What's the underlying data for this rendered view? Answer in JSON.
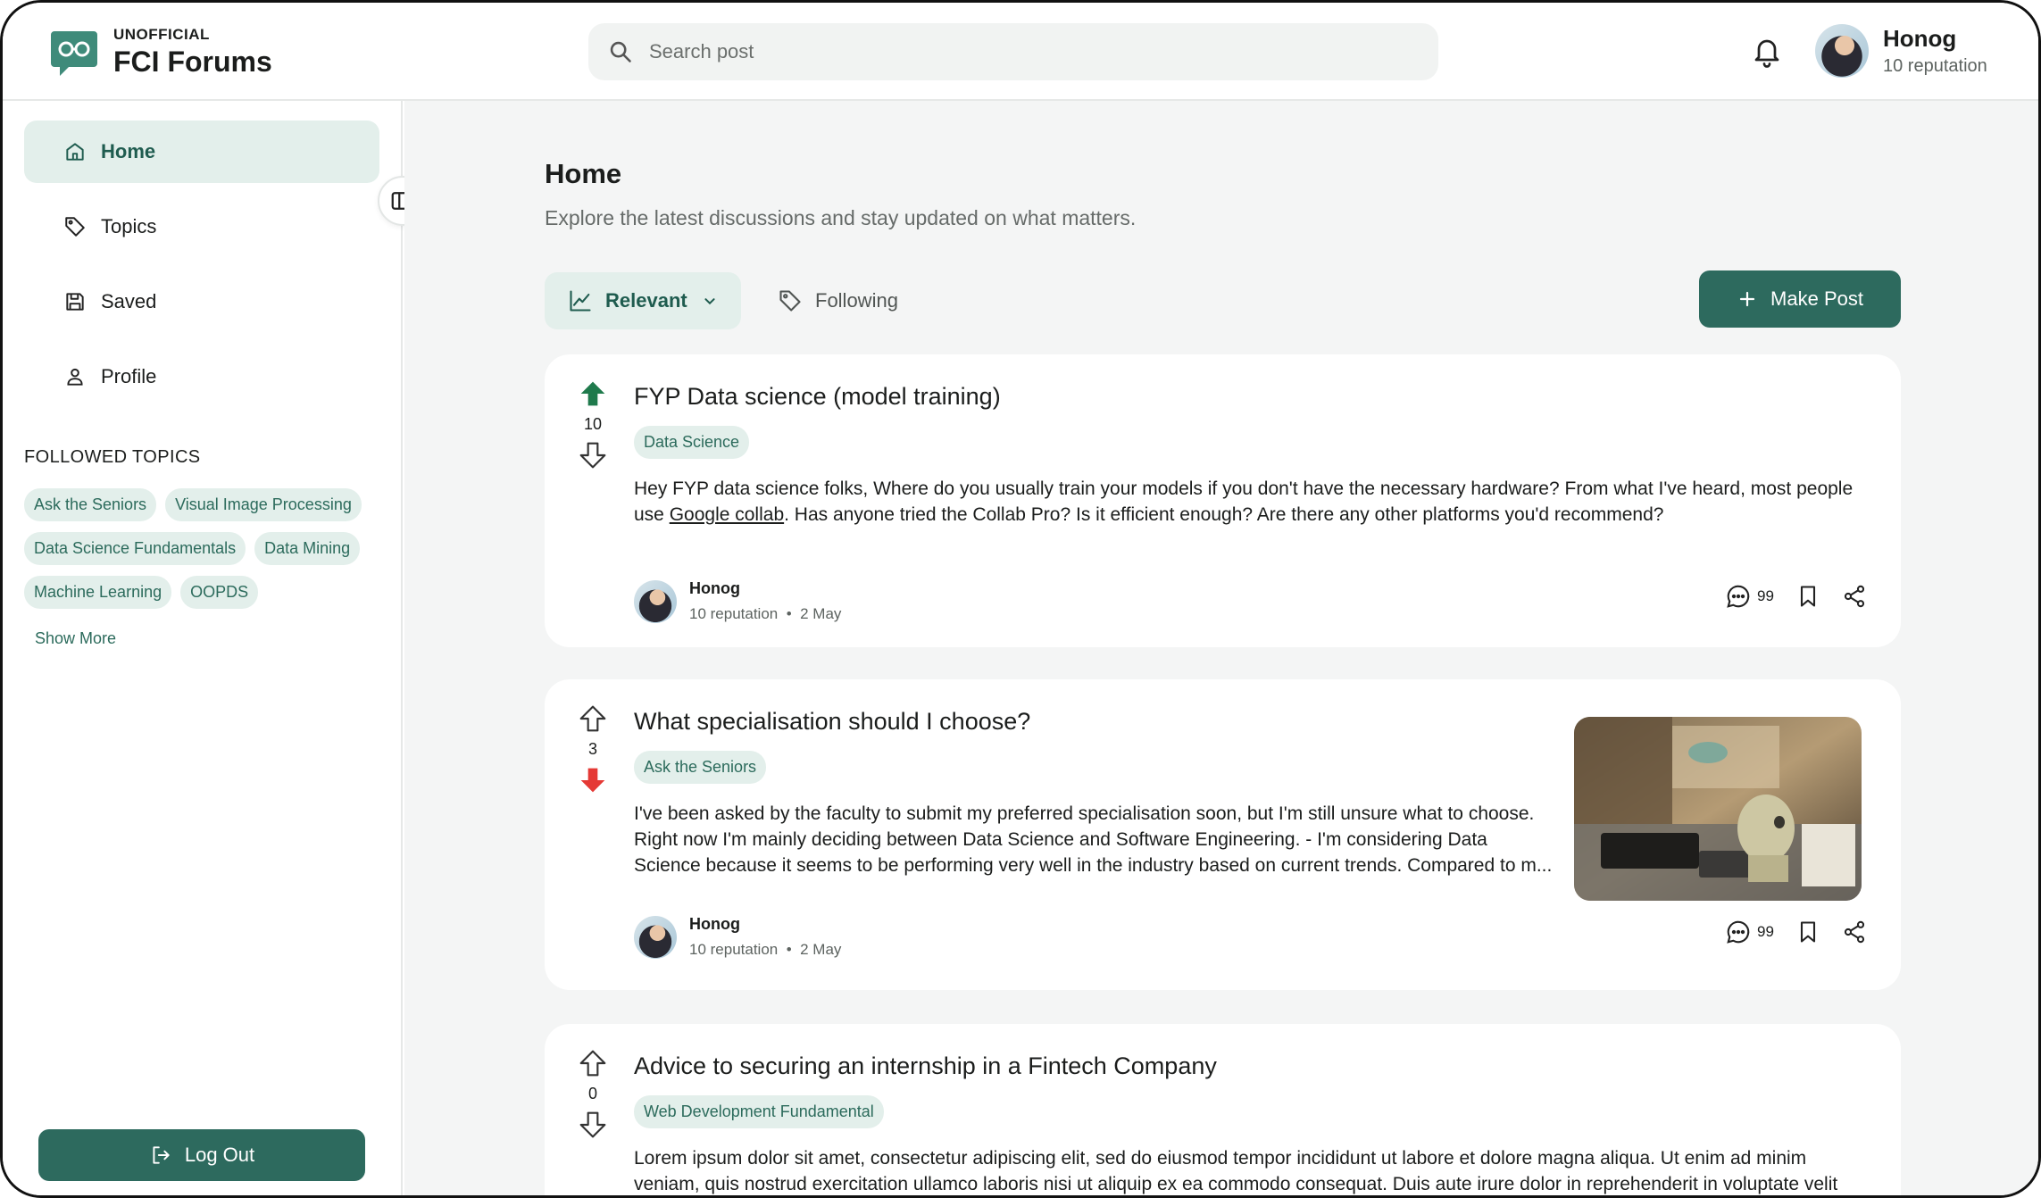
{
  "header": {
    "logo_small": "UNOFFICIAL",
    "logo_big": "FCI Forums",
    "search_placeholder": "Search post",
    "user": {
      "name": "Honog",
      "reputation": "10 reputation"
    }
  },
  "sidebar": {
    "nav": [
      {
        "label": "Home",
        "icon": "home-icon",
        "active": true
      },
      {
        "label": "Topics",
        "icon": "tag-icon"
      },
      {
        "label": "Saved",
        "icon": "save-icon"
      },
      {
        "label": "Profile",
        "icon": "user-icon"
      }
    ],
    "followed_title": "FOLLOWED TOPICS",
    "topics": [
      "Ask the Seniors",
      "Visual Image Processing",
      "Data Science Fundamentals",
      "Data Mining",
      "Machine Learning",
      "OOPDS"
    ],
    "show_more": "Show More",
    "logout": "Log Out"
  },
  "main": {
    "title": "Home",
    "subtitle": "Explore the latest discussions and stay updated on what matters.",
    "filter_relevant": "Relevant",
    "filter_following": "Following",
    "make_post": "Make Post",
    "posts": [
      {
        "title": "FYP Data science (model training)",
        "votes": "10",
        "tag": "Data Science",
        "body_line1": "Hey FYP data science folks, Where do you usually train your models if you don't have the necessary hardware? From what I've heard, most people",
        "body_line2_pre": "use ",
        "body_link": "Google collab",
        "body_line2_post": ". Has anyone tried the Collab Pro? Is it efficient enough? Are there any other platforms you'd recommend?",
        "author": "Honog",
        "author_rep": "10 reputation",
        "date": "2 May",
        "comments": "99",
        "vote_state": "up"
      },
      {
        "title": "What specialisation should I choose?",
        "votes": "3",
        "tag": "Ask the Seniors",
        "body_line1": "I've been asked by the faculty to submit my preferred specialisation soon, but I'm still unsure what to choose.",
        "body_line2": "Right now I'm mainly deciding between Data Science and Software Engineering. - I'm considering Data",
        "body_line3": "Science because it seems to be performing very well in the industry based on current trends. Compared to m...",
        "author": "Honog",
        "author_rep": "10 reputation",
        "date": "2 May",
        "comments": "99",
        "vote_state": "down"
      },
      {
        "title": "Advice to securing an internship in a Fintech Company",
        "votes": "0",
        "tag": "Web Development Fundamental",
        "body_line1": "Lorem ipsum dolor sit amet, consectetur adipiscing elit, sed do eiusmod tempor incididunt ut labore et dolore magna aliqua. Ut enim ad minim",
        "body_line2": "veniam, quis nostrud exercitation ullamco laboris nisi ut aliquip ex ea commodo consequat. Duis aute irure dolor in reprehenderit in voluptate velit",
        "vote_state": "none"
      }
    ]
  },
  "colors": {
    "accent": "#2d6a5e",
    "chip_bg": "#e3efeb",
    "upvote": "#1f7a4c",
    "downvote": "#e53935"
  },
  "separator": "•"
}
